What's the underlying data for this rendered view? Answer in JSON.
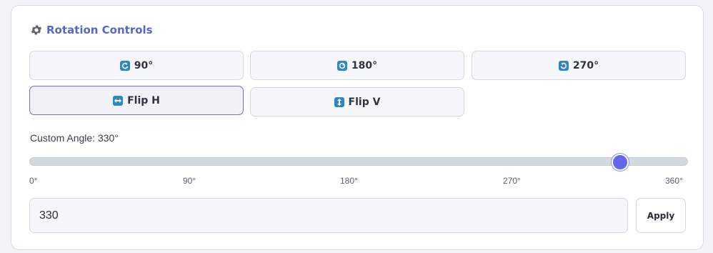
{
  "panel": {
    "title": "Rotation Controls",
    "icon": "gear-icon"
  },
  "rotate_buttons": [
    {
      "label": "90°",
      "icon": "rotate-cw-icon"
    },
    {
      "label": "180°",
      "icon": "rotate-180-icon"
    },
    {
      "label": "270°",
      "icon": "rotate-ccw-icon"
    }
  ],
  "flip_buttons": [
    {
      "label": "Flip H",
      "icon": "flip-horizontal-icon",
      "active": true
    },
    {
      "label": "Flip V",
      "icon": "flip-vertical-icon",
      "active": false
    }
  ],
  "custom_angle": {
    "label": "Custom Angle: 330°",
    "value": 330,
    "min": 0,
    "max": 360,
    "ticks": [
      "0°",
      "90°",
      "180°",
      "270°",
      "360°"
    ]
  },
  "angle_input": {
    "value": "330"
  },
  "apply_button": {
    "label": "Apply"
  },
  "colors": {
    "accent": "#6567ea",
    "title": "#5b64c8",
    "icon_bg": "#2f86c5"
  }
}
